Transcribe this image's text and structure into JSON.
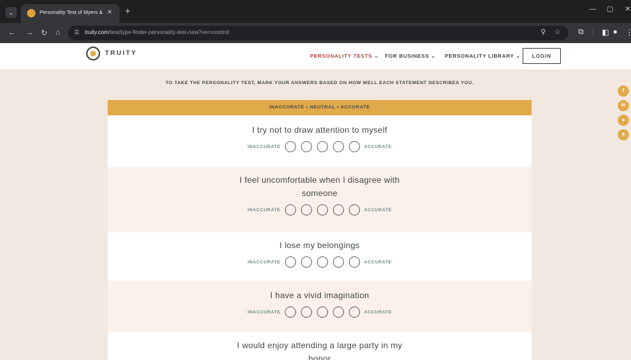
{
  "browser": {
    "tab_title": "Personality Test of Myers & Bri",
    "url_host": "truity.com",
    "url_path": "/test/type-finder-personality-test-new?ver=control"
  },
  "site": {
    "logo_text": "TRUITY",
    "nav": [
      {
        "label": "PERSONALITY TESTS ⌄"
      },
      {
        "label": "FOR BUSINESS ⌄"
      },
      {
        "label": "PERSONALITY LIBRARY ⌄"
      }
    ],
    "login_label": "LOGIN"
  },
  "instruction": "TO TAKE THE PERSONALITY TEST, MARK YOUR ANSWERS BASED ON HOW WELL EACH STATEMENT DESCRIBES YOU.",
  "scale_header": "INACCURATE  •  NEUTRAL  •  ACCURATE",
  "scale_labels": {
    "left": "INACCURATE",
    "right": "ACCURATE"
  },
  "questions": [
    {
      "text": "I try not to draw attention to myself"
    },
    {
      "text": "I feel uncomfortable when I disagree with someone"
    },
    {
      "text": "I lose my belongings"
    },
    {
      "text": "I have a vivid imagination"
    },
    {
      "text": "I would enjoy attending a large party in my honor"
    }
  ],
  "social_icons": [
    "facebook-icon",
    "linkedin-icon",
    "reddit-icon",
    "twitter-icon"
  ],
  "colors": {
    "accent": "#e0a94a",
    "brand_dark": "#3f4744",
    "nav_active": "#b5493f",
    "scale_text": "#6a8e86"
  }
}
